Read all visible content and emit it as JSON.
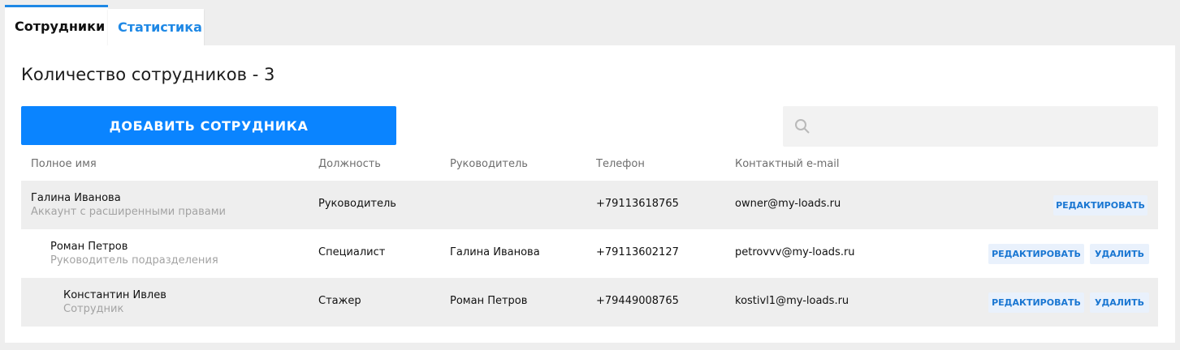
{
  "tabs": [
    {
      "label": "Сотрудники",
      "active": true
    },
    {
      "label": "Статистика",
      "active": false
    }
  ],
  "header": {
    "count_title": "Количество сотрудников - 3",
    "add_button": "ДОБАВИТЬ СОТРУДНИКА",
    "search_placeholder": ""
  },
  "table": {
    "columns": [
      "Полное имя",
      "Должность",
      "Руководитель",
      "Телефон",
      "Контактный e-mail"
    ],
    "rows": [
      {
        "name": "Галина Иванова",
        "role": "Аккаунт с расширенными правами",
        "position": "Руководитель",
        "manager": "",
        "phone": "+79113618765",
        "email": "owner@my-loads.ru",
        "edit_label": "РЕДАКТИРОВАТЬ",
        "delete_label": ""
      },
      {
        "name": "Роман Петров",
        "role": "Руководитель подразделения",
        "position": "Специалист",
        "manager": "Галина Иванова",
        "phone": "+79113602127",
        "email": "petrovvv@my-loads.ru",
        "edit_label": "РЕДАКТИРОВАТЬ",
        "delete_label": "УДАЛИТЬ"
      },
      {
        "name": "Константин Ивлев",
        "role": "Сотрудник",
        "position": "Стажер",
        "manager": "Роман Петров",
        "phone": "+79449008765",
        "email": "kostivl1@my-loads.ru",
        "edit_label": "РЕДАКТИРОВАТЬ",
        "delete_label": "УДАЛИТЬ"
      }
    ]
  },
  "colors": {
    "accent": "#0a84ff",
    "tab_active_border": "#1e88e5",
    "row_shade": "#eeeeee",
    "action_bg": "#e9f1fc",
    "action_text": "#1976d2"
  },
  "icons": {
    "search": "search-icon"
  }
}
